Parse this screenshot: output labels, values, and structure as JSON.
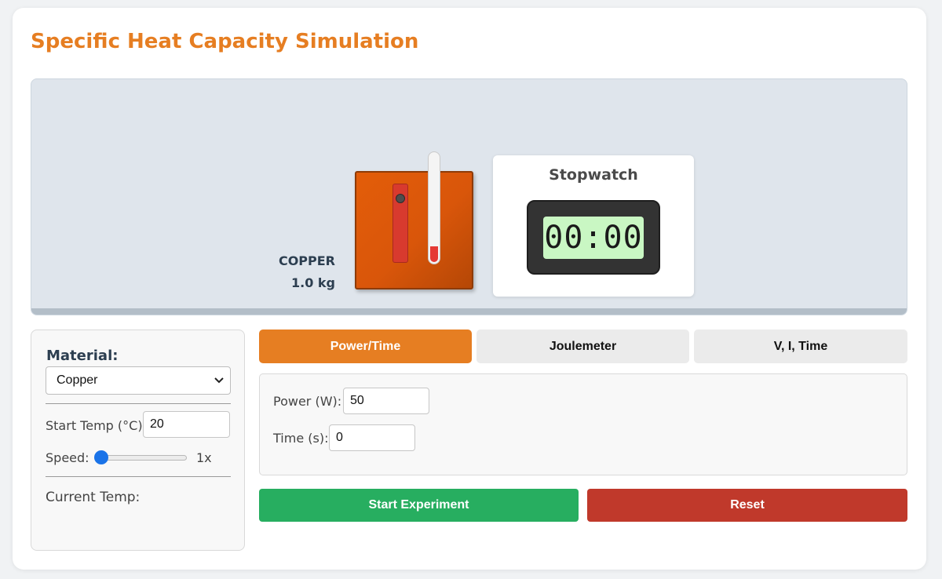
{
  "app": {
    "title": "Specific Heat Capacity Simulation"
  },
  "stage": {
    "material_name": "COPPER",
    "mass": "1.0 kg",
    "stopwatch": {
      "title": "Stopwatch",
      "display": "00:00"
    }
  },
  "controls": {
    "material_label": "Material:",
    "material_selected": "Copper",
    "start_temp_label": "Start Temp (°C):",
    "start_temp_value": "20",
    "speed_label": "Speed:",
    "speed_value": "1x",
    "speed_level": 0,
    "current_temp_label": "Current Temp:"
  },
  "tabs": [
    {
      "label": "Power/Time",
      "active": true
    },
    {
      "label": "Joulemeter",
      "active": false
    },
    {
      "label": "V, I, Time",
      "active": false
    }
  ],
  "fields": {
    "power_label": "Power (W):",
    "power_value": "50",
    "time_label": "Time (s):",
    "time_value": "0"
  },
  "actions": {
    "start_label": "Start Experiment",
    "reset_label": "Reset"
  },
  "colors": {
    "accent": "#e67e22",
    "start": "#27ae60",
    "reset": "#c0392b",
    "block": "#d9560a",
    "lcd": "#c9f7c3"
  }
}
